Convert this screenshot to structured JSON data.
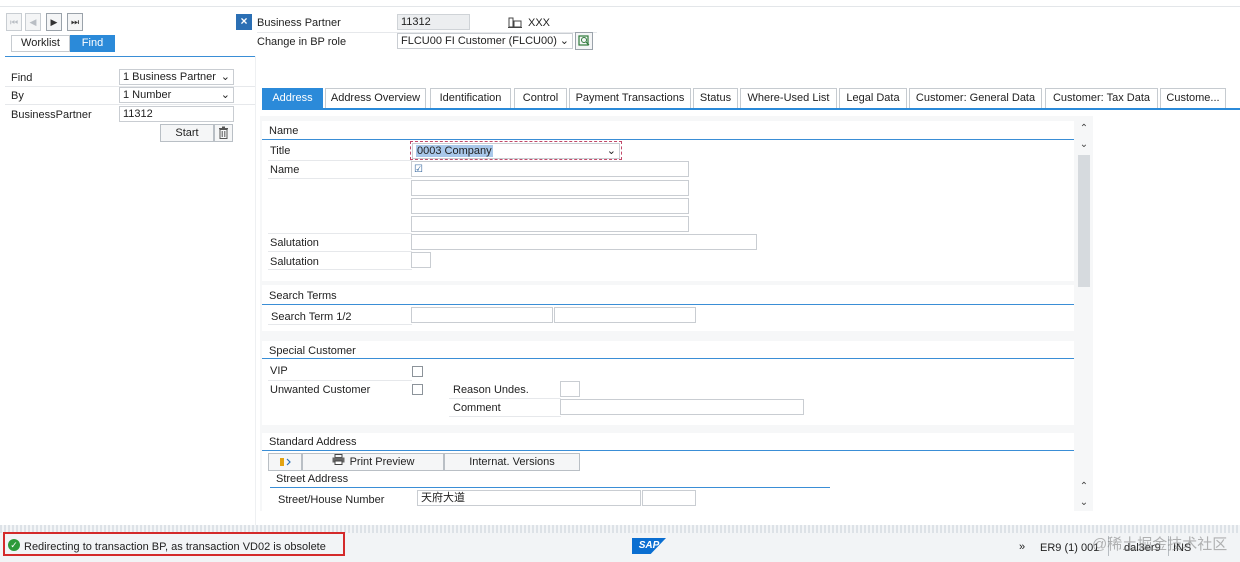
{
  "nav": {
    "first_icon": "⏮",
    "prev_icon": "◀",
    "next_icon": "▶",
    "last_icon": "⏭"
  },
  "left_tabs": {
    "worklist": "Worklist",
    "find": "Find"
  },
  "search": {
    "find_label": "Find",
    "find_value": "1 Business Partner",
    "by_label": "By",
    "by_value": "1 Number",
    "bp_label": "BusinessPartner",
    "bp_value": "11312",
    "start_label": "Start",
    "trash_icon": "trash-icon"
  },
  "header": {
    "close_icon": "×",
    "bp_label": "Business Partner",
    "bp_value": "11312",
    "org_name": "XXX",
    "role_label": "Change in BP role",
    "role_value": "FLCU00 FI Customer (FLCU00) ..."
  },
  "tabs": [
    "Address",
    "Address Overview",
    "Identification",
    "Control",
    "Payment Transactions",
    "Status",
    "Where-Used List",
    "Legal Data",
    "Customer: General Data",
    "Customer: Tax Data",
    "Custome..."
  ],
  "name_section": {
    "title": "Name",
    "title_label": "Title",
    "title_value": "0003 Company",
    "name_label": "Name",
    "salutation_label": "Salutation",
    "salutation2_label": "Salutation"
  },
  "search_terms": {
    "title": "Search Terms",
    "term_label": "Search Term 1/2"
  },
  "special_customer": {
    "title": "Special Customer",
    "vip_label": "VIP",
    "unwanted_label": "Unwanted Customer",
    "reason_label": "Reason Undes.",
    "comment_label": "Comment"
  },
  "standard_address": {
    "title": "Standard Address",
    "print_preview": "Print Preview",
    "intl_versions": "Internat. Versions",
    "street_title": "Street Address",
    "street_label": "Street/House Number",
    "street_value": "天府大道"
  },
  "status_bar": {
    "message": "Redirecting to transaction BP, as transaction VD02 is obsolete",
    "sap_logo": "SAP",
    "system_info": "ER9 (1) 001",
    "host": "dal3er9",
    "mode": "INS",
    "watermark": "@稀土掘金技术社区"
  },
  "colors": {
    "accent": "#2b8ad9",
    "status_green": "#2e9a3a",
    "highlight_red": "#d42a2a",
    "sap_blue": "#0a6ed1"
  }
}
